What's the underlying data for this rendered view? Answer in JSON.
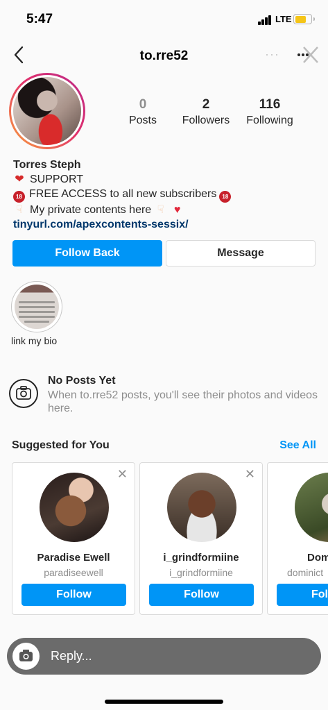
{
  "status_bar": {
    "time": "5:47",
    "network": "LTE"
  },
  "nav": {
    "title": "to.rre52",
    "more": "···"
  },
  "profile": {
    "stats": [
      {
        "value": "0",
        "label": "Posts"
      },
      {
        "value": "2",
        "label": "Followers"
      },
      {
        "value": "116",
        "label": "Following"
      }
    ],
    "name": "Torres Steph",
    "bio": {
      "line1": "SUPPORT",
      "line2": "FREE ACCESS to all new subscribers",
      "line3": "My private contents here",
      "link": "tinyurl.com/apexcontents-sessix/"
    }
  },
  "actions": {
    "follow_back": "Follow Back",
    "message": "Message"
  },
  "highlight": {
    "label": "link my bio"
  },
  "empty_state": {
    "title": "No Posts Yet",
    "text": "When to.rre52 posts, you'll see their photos and videos here."
  },
  "suggested": {
    "title": "Suggested for You",
    "see_all": "See All",
    "cards": [
      {
        "name": "Paradise Ewell",
        "handle": "paradiseewell",
        "button": "Follow"
      },
      {
        "name": "i_grindformiine",
        "handle": "i_grindformiine",
        "button": "Follow"
      },
      {
        "name": "Dom",
        "handle": "dominict",
        "button": "Fol"
      }
    ]
  },
  "reply": {
    "placeholder": "Reply..."
  },
  "colors": {
    "accent": "#0095f6",
    "link": "#00376b",
    "battery": "#f5c518"
  }
}
